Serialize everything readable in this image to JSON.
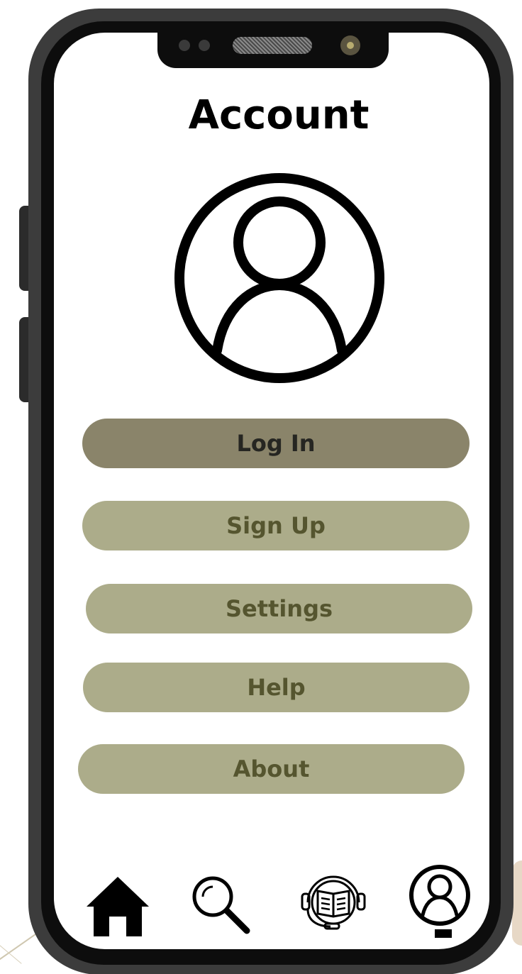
{
  "screen": {
    "title": "Account"
  },
  "menu": {
    "items": [
      {
        "label": "Log In",
        "state": "active"
      },
      {
        "label": "Sign Up",
        "state": "default"
      },
      {
        "label": "Settings",
        "state": "default"
      },
      {
        "label": "Help",
        "state": "default"
      },
      {
        "label": "About",
        "state": "default"
      }
    ]
  },
  "bottom_nav": {
    "items": [
      {
        "icon": "home-icon"
      },
      {
        "icon": "search-icon"
      },
      {
        "icon": "audiobook-icon"
      },
      {
        "icon": "account-icon",
        "selected": true
      }
    ]
  },
  "colors": {
    "button_default_bg": "#acac8a",
    "button_default_text": "#55552f",
    "button_active_bg": "#8a846a",
    "button_active_text": "#262622",
    "phone_frame": "#3c3c3c"
  }
}
